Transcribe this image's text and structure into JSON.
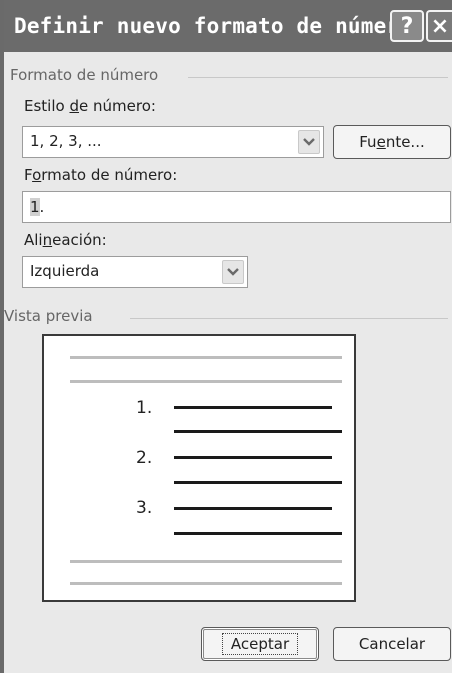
{
  "dialog": {
    "title": "Definir nuevo formato de número",
    "help_label": "?",
    "close_label": "×"
  },
  "format_group": {
    "label": "Formato de número",
    "style_label_pre": "Estilo ",
    "style_label_mnemonic": "d",
    "style_label_post": "e número:",
    "style_value": "1, 2, 3, ...",
    "font_button_pre": "Fu",
    "font_button_mnemonic": "e",
    "font_button_post": "nte...",
    "format_label_pre": "F",
    "format_label_mnemonic": "o",
    "format_label_post": "rmato de número:",
    "format_value_field": "1",
    "format_value_suffix": ".",
    "alignment_label_pre": "Ali",
    "alignment_label_mnemonic": "n",
    "alignment_label_post": "eación:",
    "alignment_value": "Izquierda"
  },
  "preview_group": {
    "label": "Vista previa",
    "numbers": [
      "1.",
      "2.",
      "3."
    ]
  },
  "buttons": {
    "ok": "Aceptar",
    "cancel": "Cancelar"
  },
  "colors": {
    "title_bar": "#6b6b6b",
    "dialog_bg": "#e9e9e9",
    "preview_line": "#1a1a1a",
    "preview_grey": "#bdbdbd"
  }
}
